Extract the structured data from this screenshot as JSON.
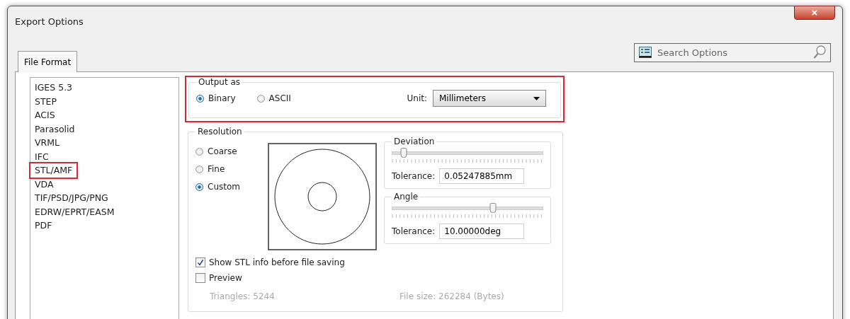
{
  "window": {
    "title": "Export Options",
    "close": "×"
  },
  "tabs": [
    {
      "label": "File Format",
      "selected": true
    }
  ],
  "search": {
    "placeholder": "Search Options"
  },
  "formats": [
    {
      "label": "IGES 5.3",
      "highlighted": false
    },
    {
      "label": "STEP",
      "highlighted": false
    },
    {
      "label": "ACIS",
      "highlighted": false
    },
    {
      "label": "Parasolid",
      "highlighted": false
    },
    {
      "label": "VRML",
      "highlighted": false
    },
    {
      "label": "IFC",
      "highlighted": false
    },
    {
      "label": "STL/AMF",
      "highlighted": true
    },
    {
      "label": "VDA",
      "highlighted": false
    },
    {
      "label": "TIF/PSD/JPG/PNG",
      "highlighted": false
    },
    {
      "label": "EDRW/EPRT/EASM",
      "highlighted": false
    },
    {
      "label": "PDF",
      "highlighted": false
    }
  ],
  "output": {
    "title": "Output as",
    "highlighted": true,
    "options": [
      {
        "label": "Binary",
        "selected": true
      },
      {
        "label": "ASCII",
        "selected": false
      }
    ],
    "unit_label": "Unit:",
    "unit_value": "Millimeters"
  },
  "resolution": {
    "title": "Resolution",
    "options": [
      {
        "label": "Coarse",
        "selected": false
      },
      {
        "label": "Fine",
        "selected": false
      },
      {
        "label": "Custom",
        "selected": true
      }
    ],
    "groups": [
      {
        "title": "Deviation",
        "level": 0.08,
        "tolerance_label": "Tolerance:",
        "tolerance": "0.05247885mm"
      },
      {
        "title": "Angle",
        "level": 0.67,
        "tolerance_label": "Tolerance:",
        "tolerance": "10.00000deg"
      }
    ],
    "checkboxes": [
      {
        "label": "Show STL info before file saving",
        "checked": true
      },
      {
        "label": "Preview",
        "checked": false
      }
    ],
    "triangles": "Triangles: 5244",
    "file_size": "File size: 262284 (Bytes)"
  }
}
